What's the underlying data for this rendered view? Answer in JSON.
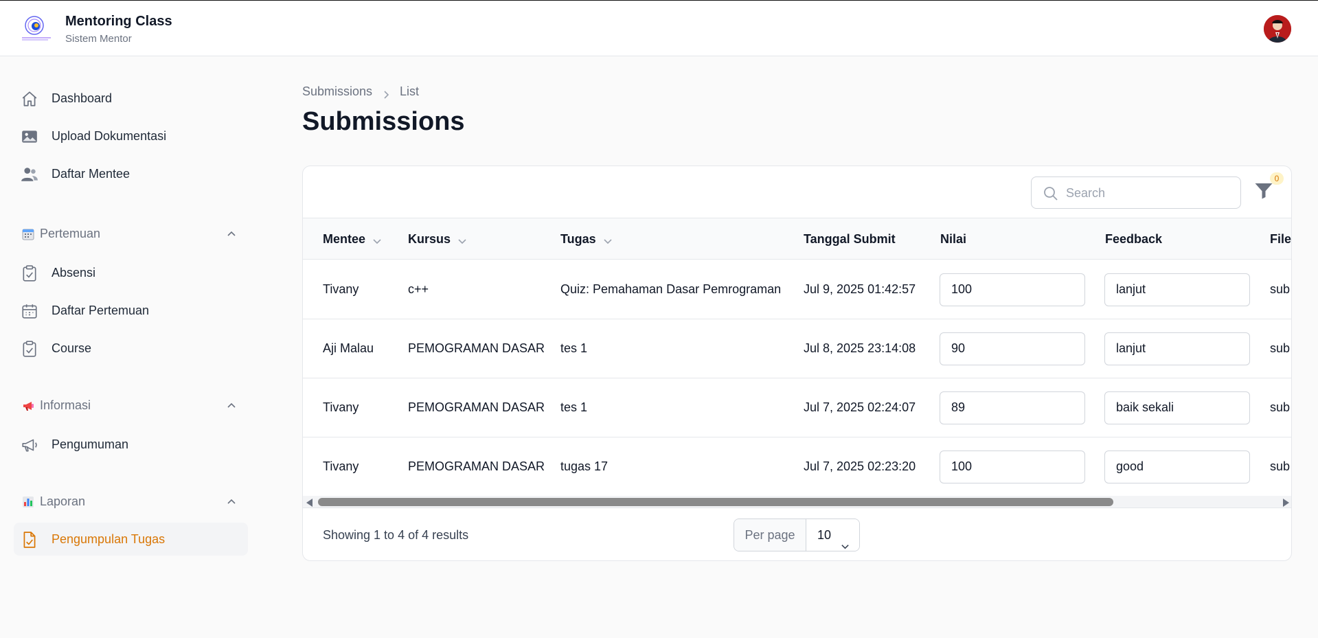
{
  "app": {
    "title": "Mentoring Class",
    "subtitle": "Sistem Mentor",
    "colors": {
      "accent": "#d97706",
      "text": "#111827",
      "muted": "#6b7280",
      "border": "#e5e7eb"
    }
  },
  "sidebar": {
    "items": [
      {
        "label": "Dashboard",
        "icon": "home-icon"
      },
      {
        "label": "Upload Dokumentasi",
        "icon": "image-icon"
      },
      {
        "label": "Daftar Mentee",
        "icon": "users-icon"
      }
    ],
    "groups": [
      {
        "label": "Pertemuan",
        "icon": "calendar-emoji-icon",
        "items": [
          {
            "label": "Absensi",
            "icon": "clipboard-check-icon"
          },
          {
            "label": "Daftar Pertemuan",
            "icon": "calendar-icon"
          },
          {
            "label": "Course",
            "icon": "clipboard-check-icon"
          }
        ]
      },
      {
        "label": "Informasi",
        "icon": "megaphone-emoji-icon",
        "items": [
          {
            "label": "Pengumuman",
            "icon": "megaphone-icon"
          }
        ]
      },
      {
        "label": "Laporan",
        "icon": "bar-chart-emoji-icon",
        "items": [
          {
            "label": "Pengumpulan Tugas",
            "icon": "document-check-icon",
            "active": true
          }
        ]
      }
    ]
  },
  "breadcrumb": [
    "Submissions",
    "List"
  ],
  "page_title": "Submissions",
  "toolbar": {
    "search_placeholder": "Search",
    "filter_count": "0"
  },
  "table": {
    "columns": [
      "Mentee",
      "Kursus",
      "Tugas",
      "Tanggal Submit",
      "Nilai",
      "Feedback",
      "File"
    ],
    "rows": [
      {
        "mentee": "Tivany",
        "kursus": "c++",
        "tugas": "Quiz: Pemahaman Dasar Pemrograman",
        "tanggal": "Jul 9, 2025 01:42:57",
        "nilai": "100",
        "feedback": "lanjut",
        "file": "sub"
      },
      {
        "mentee": "Aji Malau",
        "kursus": "PEMOGRAMAN DASAR",
        "tugas": "tes 1",
        "tanggal": "Jul 8, 2025 23:14:08",
        "nilai": "90",
        "feedback": "lanjut",
        "file": "sub"
      },
      {
        "mentee": "Tivany",
        "kursus": "PEMOGRAMAN DASAR",
        "tugas": "tes 1",
        "tanggal": "Jul 7, 2025 02:24:07",
        "nilai": "89",
        "feedback": "baik sekali",
        "file": "sub"
      },
      {
        "mentee": "Tivany",
        "kursus": "PEMOGRAMAN DASAR",
        "tugas": "tugas 17",
        "tanggal": "Jul 7, 2025 02:23:20",
        "nilai": "100",
        "feedback": "good",
        "file": "sub"
      }
    ]
  },
  "footer": {
    "summary": "Showing 1 to 4 of 4 results",
    "per_page_label": "Per page",
    "per_page_value": "10"
  }
}
